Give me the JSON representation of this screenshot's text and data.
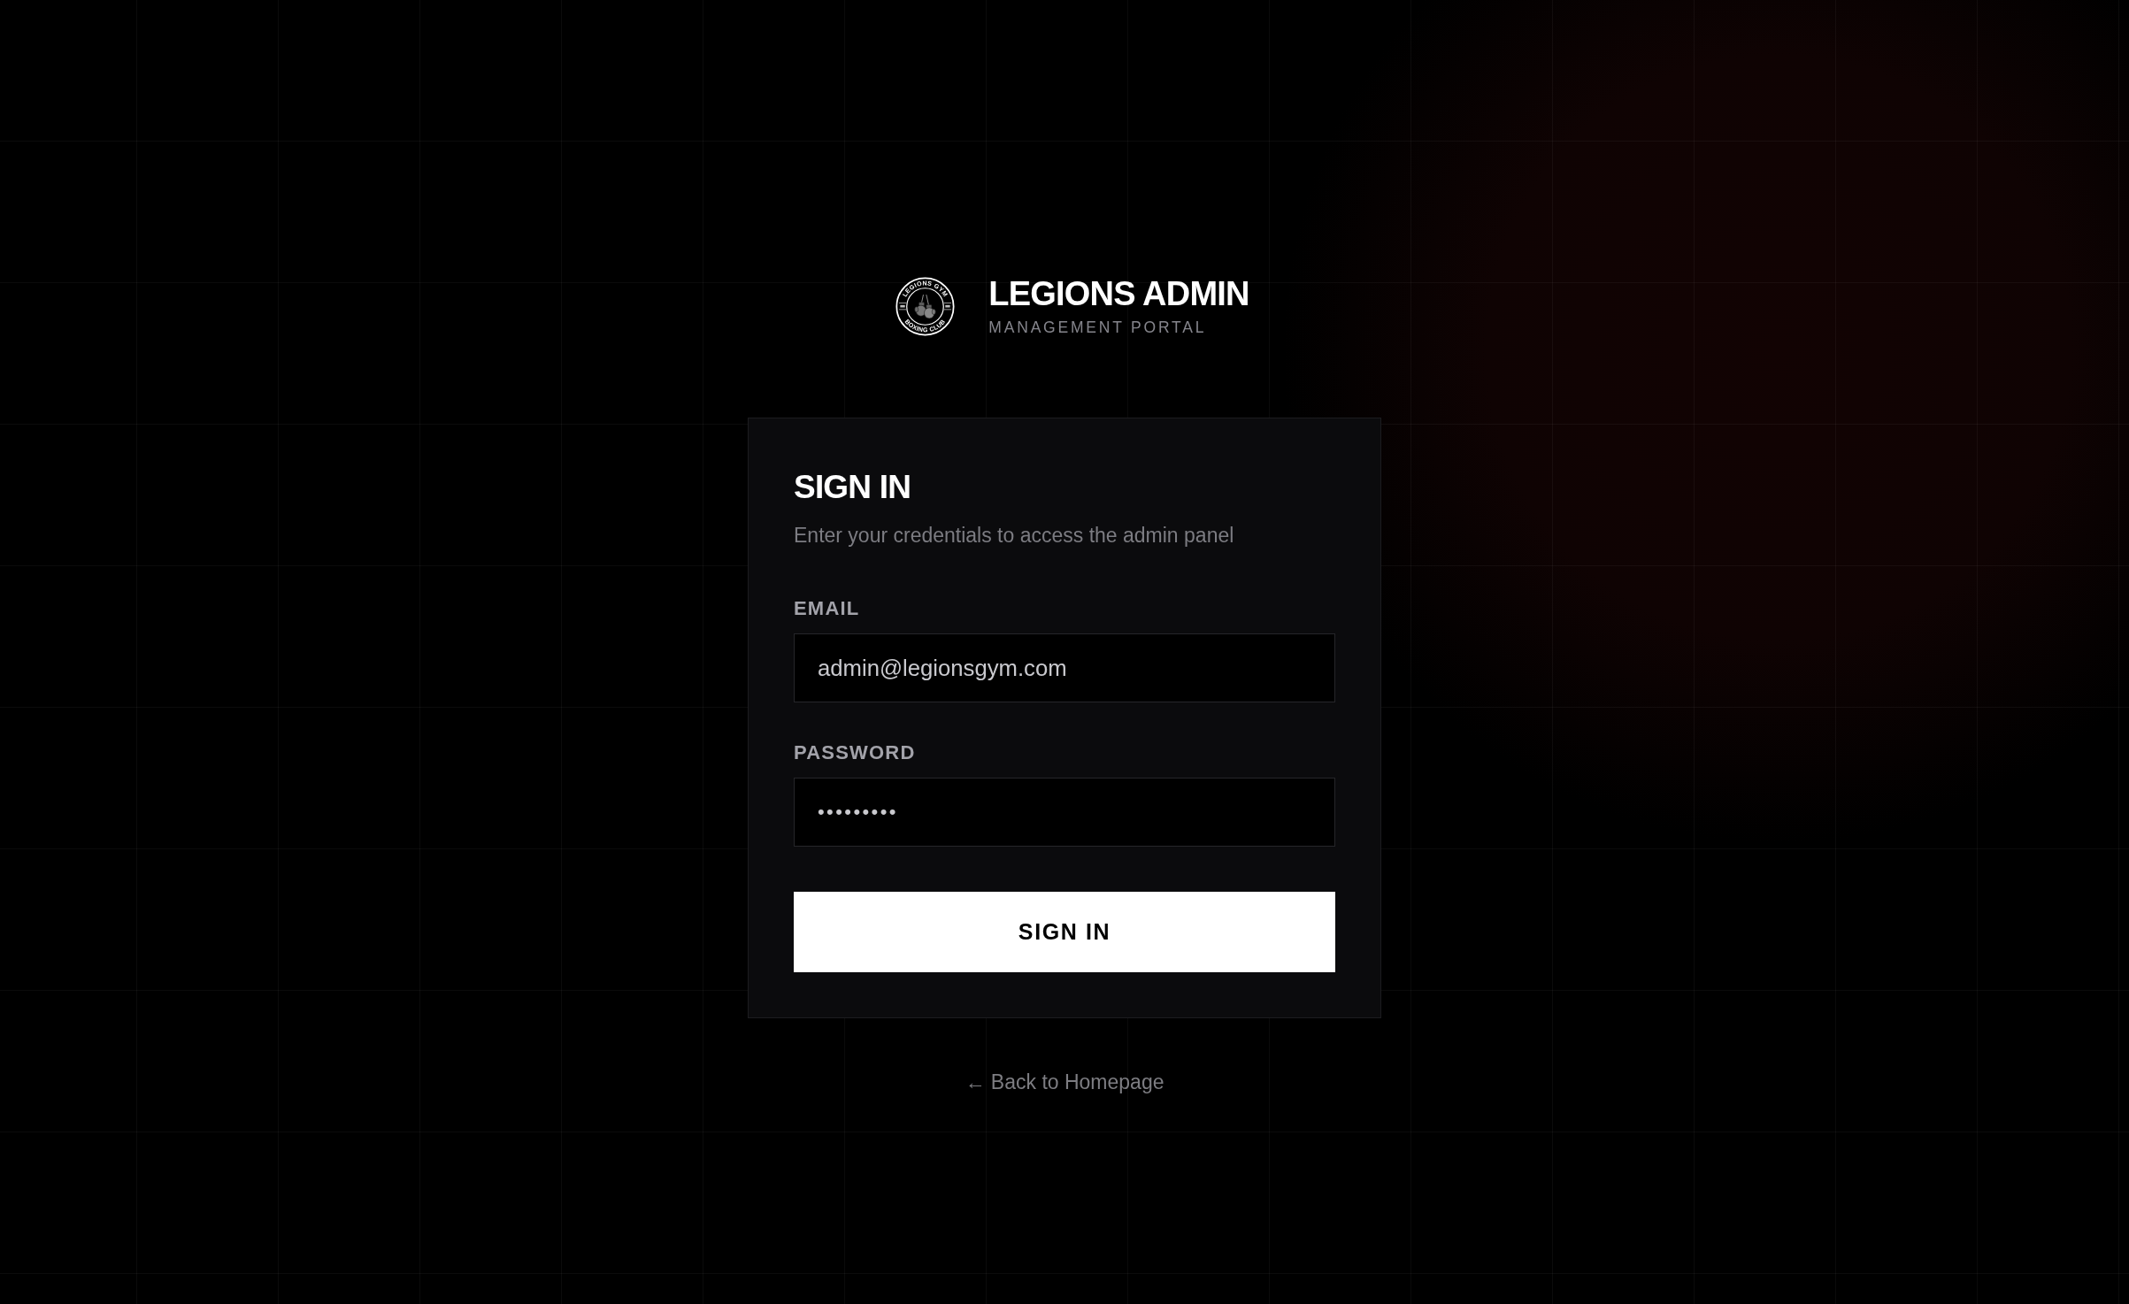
{
  "brand": {
    "logo": {
      "top_text": "LEGIONS GYM",
      "bottom_text": "BOXING CLUB"
    },
    "title": "LEGIONS ADMIN",
    "subtitle": "MANAGEMENT PORTAL"
  },
  "sign_in": {
    "title": "SIGN IN",
    "description": "Enter your credentials to access the admin panel",
    "fields": [
      {
        "label": "EMAIL",
        "kind": "email",
        "value": "admin@legionsgym.com"
      },
      {
        "label": "PASSWORD",
        "kind": "password",
        "value": "•••••••••"
      }
    ],
    "submit": "SIGN IN"
  },
  "back_link": "← Back to Homepage"
}
